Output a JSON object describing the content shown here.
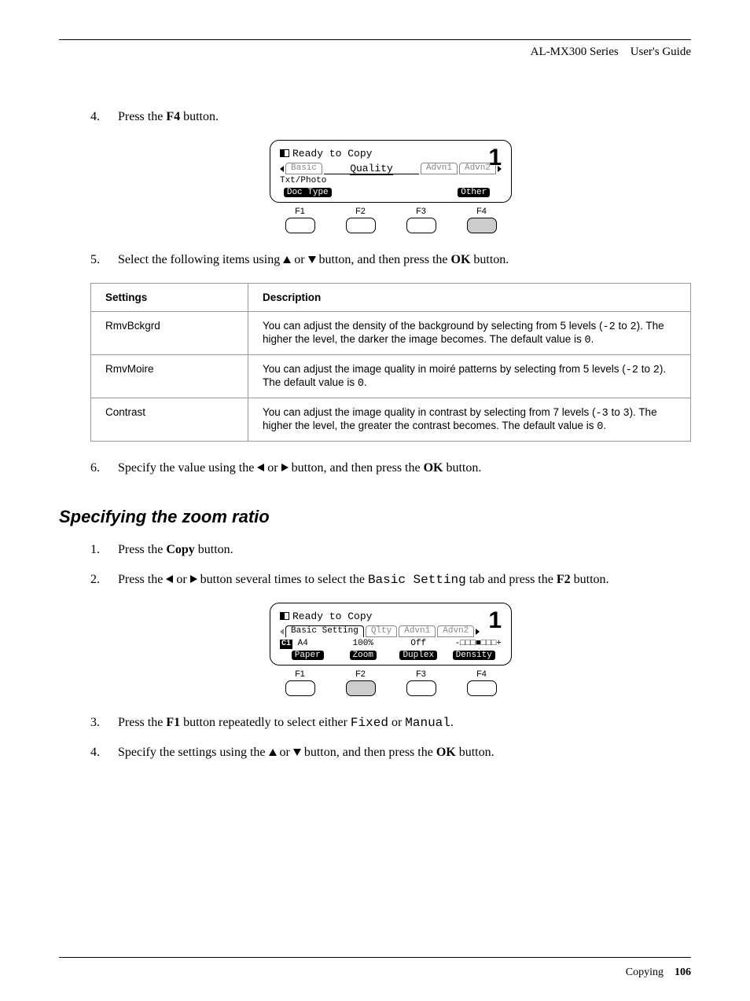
{
  "header": {
    "series": "AL-MX300 Series",
    "guide": "User's Guide"
  },
  "step4": {
    "num": "4.",
    "text_pre": "Press the ",
    "bold": "F4",
    "text_post": " button."
  },
  "lcd1": {
    "title": "Ready to Copy",
    "big": "1",
    "tabs": {
      "t1": "Basic",
      "t2": "Quality",
      "t3": "Advn1",
      "t4": "Advn2"
    },
    "value": "Txt/Photo",
    "labels": {
      "l1": "Doc Type",
      "l4": "Other"
    },
    "fkeys": [
      "F1",
      "F2",
      "F3",
      "F4"
    ]
  },
  "step5": {
    "num": "5.",
    "text_pre": "Select the following items using ",
    "text_mid": " or ",
    "text_post": " button, and then press the ",
    "bold": "OK",
    "text_end": " button."
  },
  "table": {
    "h1": "Settings",
    "h2": "Description",
    "rows": [
      {
        "setting": "RmvBckgrd",
        "desc_pre": "You can adjust the density of the background by selecting from 5 levels (",
        "m1": "-2",
        "d1": " to ",
        "m2": "2",
        "d2": "). The higher the level, the darker the image becomes. The default value is ",
        "m3": "0",
        "d3": "."
      },
      {
        "setting": "RmvMoire",
        "desc_pre": "You can adjust the image quality in moiré patterns by selecting from 5 levels (",
        "m1": "-2",
        "d1": " to ",
        "m2": "2",
        "d2": "). The default value is ",
        "m3": "0",
        "d3": "."
      },
      {
        "setting": "Contrast",
        "desc_pre": "You can adjust the image quality in contrast by selecting from 7 levels (",
        "m1": "-3",
        "d1": " to ",
        "m2": "3",
        "d2": "). The higher the level, the greater the contrast becomes. The default value is ",
        "m3": "0",
        "d3": "."
      }
    ]
  },
  "step6": {
    "num": "6.",
    "text_pre": "Specify the value using the ",
    "text_mid": " or ",
    "text_post": " button, and then press the ",
    "bold": "OK",
    "text_end": " button."
  },
  "section": "Specifying the zoom ratio",
  "stepZ1": {
    "num": "1.",
    "text_pre": "Press the ",
    "bold": "Copy",
    "text_post": " button."
  },
  "stepZ2": {
    "num": "2.",
    "text_pre": "Press the ",
    "text_mid": " or ",
    "text_post": " button several times to select the ",
    "mono": "Basic Setting",
    "text_after": " tab and press the ",
    "bold": "F2",
    "text_end": " button."
  },
  "lcd2": {
    "title": "Ready to Copy",
    "big": "1",
    "tabs": {
      "t1": "Basic Setting",
      "t2": "Qlty",
      "t3": "Advn1",
      "t4": "Advn2"
    },
    "vals": {
      "v1": "A4",
      "v2": "100%",
      "v3": "Off",
      "v4": "-□□□■□□□+"
    },
    "labels": {
      "l1": "Paper",
      "l2": "Zoom",
      "l3": "Duplex",
      "l4": "Density"
    },
    "fkeys": [
      "F1",
      "F2",
      "F3",
      "F4"
    ]
  },
  "stepZ3": {
    "num": "3.",
    "text_pre": "Press the ",
    "bold": "F1",
    "text_mid": " button repeatedly to select either ",
    "mono1": "Fixed",
    "text_or": " or ",
    "mono2": "Manual",
    "text_end": "."
  },
  "stepZ4": {
    "num": "4.",
    "text_pre": "Specify the settings using the ",
    "text_mid": " or ",
    "text_post": " button, and then press the ",
    "bold": "OK",
    "text_end": " button."
  },
  "footer": {
    "section": "Copying",
    "page": "106"
  },
  "c1icon": "C1"
}
